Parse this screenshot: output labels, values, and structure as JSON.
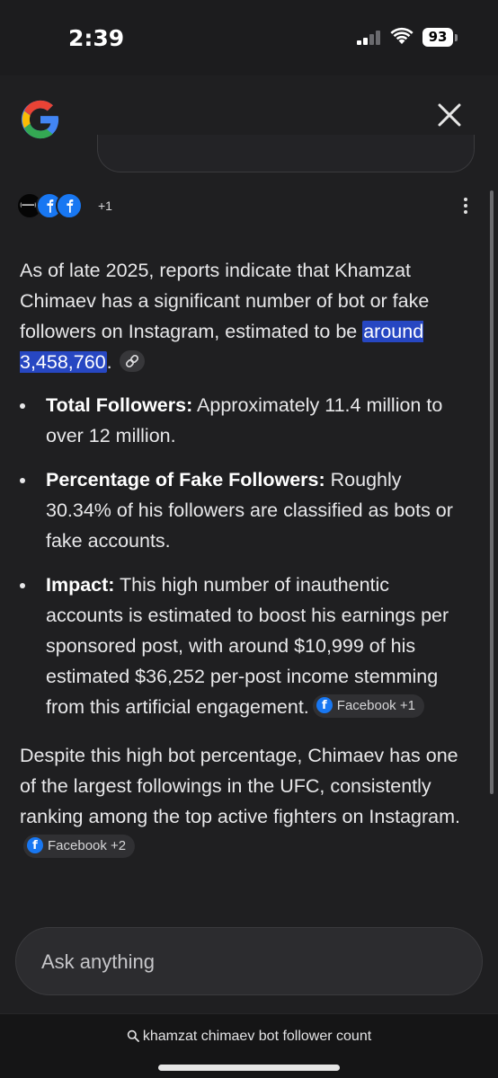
{
  "status_bar": {
    "time": "2:39",
    "battery": "93"
  },
  "header": {
    "logo": "google-logo",
    "close_icon": "close-icon"
  },
  "sources": {
    "more_count": "+1"
  },
  "answer": {
    "intro_before": "As of late 2025, reports indicate that Khamzat Chimaev has a significant number of bot or fake followers on Instagram, estimated to be ",
    "intro_highlight": "around 3,458,760",
    "intro_after": ".",
    "bullets": [
      {
        "label": "Total Followers:",
        "text": " Approximately 11.4 million to over 12 million."
      },
      {
        "label": "Percentage of Fake Followers:",
        "text": " Roughly 30.34% of his followers are classified as bots or fake accounts."
      },
      {
        "label": "Impact:",
        "text": " This high number of inauthentic accounts is estimated to boost his earnings per sponsored post, with around $10,999 of his estimated $36,252 per-post income stemming from this artificial engagement.",
        "chip": "Facebook +1"
      }
    ],
    "closing": "Despite this high bot percentage, Chimaev has one of the largest followings in the UFC, consistently ranking among the top active fighters on Instagram.",
    "closing_chip": "Facebook +2"
  },
  "ask": {
    "placeholder": "Ask anything"
  },
  "bottom": {
    "query": "khamzat chimaev bot follower count"
  },
  "colors": {
    "background": "#1f1f21",
    "highlight": "#2747c2",
    "facebook": "#1877f2"
  }
}
